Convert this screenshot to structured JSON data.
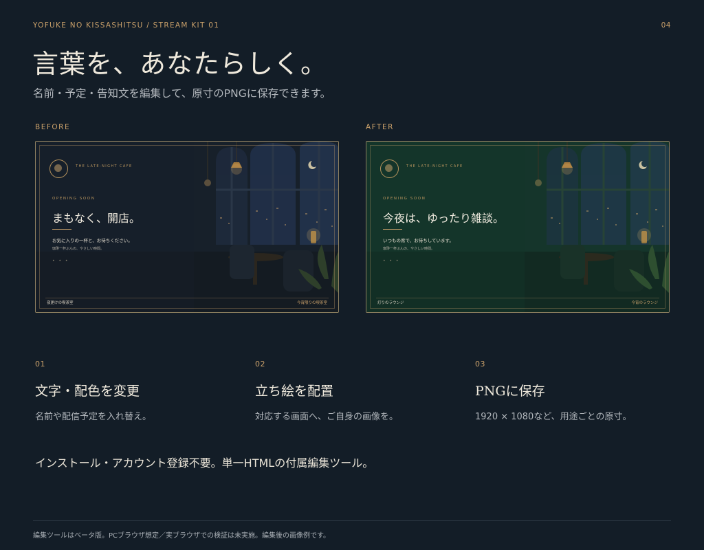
{
  "header": {
    "brand": "YOFUKE NO KISSASHITSU  /  STREAM KIT 01",
    "page_number": "04",
    "headline": "言葉を、あなたらしく。",
    "subline": "名前・予定・告知文を編集して、原寸のPNGに保存できます。"
  },
  "before": {
    "label": "BEFORE",
    "cafe_name": "THE LATE-NIGHT CAFE",
    "kicker": "OPENING SOON",
    "title": "まもなく、開店。",
    "line1": "お気に入りの一杯と、お待ちください。",
    "line2": "珈琲一杯ぶんの、やさしい時間。",
    "dots": "•  •  •",
    "footer_left": "夜更けの喫茶室",
    "footer_right": "今宵限りの喫茶室",
    "bg_color": "#17202a"
  },
  "after": {
    "label": "AFTER",
    "cafe_name": "THE LATE-NIGHT CAFE",
    "kicker": "OPENING SOON",
    "title": "今夜は、ゆったり雑談。",
    "line1": "いつもの席で、お待ちしています。",
    "line2": "珈琲一杯ぶんの、やさしい時間。",
    "dots": "•  •  •",
    "footer_left": "灯りのラウンジ",
    "footer_right": "今宵のラウンジ",
    "bg_color": "#15352b"
  },
  "steps": [
    {
      "number": "01",
      "title": "文字・配色を変更",
      "description": "名前や配信予定を入れ替え。"
    },
    {
      "number": "02",
      "title": "立ち絵を配置",
      "description": "対応する画面へ、ご自身の画像を。"
    },
    {
      "number": "03",
      "title": "PNGに保存",
      "description": "1920 × 1080など、用途ごとの原寸。"
    }
  ],
  "tagline": "インストール・アカウント登録不要。単一HTMLの付属編集ツール。",
  "footnote": "編集ツールはベータ版。PCブラウザ想定／実ブラウザでの検証は未実施。編集後の画像例です。",
  "colors": {
    "background": "#131d27",
    "accent": "#c9a06a",
    "text": "#efe9dc",
    "muted": "#b3b8bd"
  },
  "icons": {
    "cafe_logo": "cafe-emblem-icon",
    "moon": "crescent-moon-icon"
  }
}
